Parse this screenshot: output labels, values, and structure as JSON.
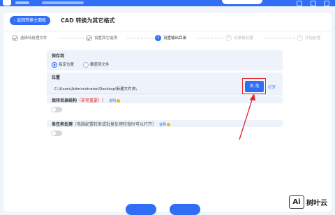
{
  "topbar": {
    "accent": "#2f6ef5"
  },
  "header": {
    "back_label": "返回转换主面板",
    "title": "CAD 转换为其它格式"
  },
  "steps": [
    {
      "num": "",
      "label": "选择待处理文件",
      "state": "done"
    },
    {
      "num": "",
      "label": "设置其它选项",
      "state": "done"
    },
    {
      "num": "3",
      "label": "设置输出目录",
      "state": "current"
    },
    {
      "num": "4",
      "label": "待录格处理",
      "state": "next"
    },
    {
      "num": "5",
      "label": "开始处理",
      "state": "next"
    }
  ],
  "save_to": {
    "label": "保存到",
    "options": [
      {
        "label": "指定位置",
        "selected": true
      },
      {
        "label": "覆盖原文件",
        "selected": false
      }
    ]
  },
  "location": {
    "label": "位置",
    "path": "C:\\Users\\Administrator\\Desktop\\新建文件夹\\",
    "browse_label": "浏 览",
    "open_label": "打开"
  },
  "keep_dir": {
    "label": "保持目录结构",
    "note": "（非常重要！）",
    "help_label": "说明",
    "enabled": false
  },
  "single_task": {
    "label": "单任务处理",
    "note": "（电脑配置较差或批量处理较慢时可以打开）",
    "help_label": "说明",
    "enabled": false
  },
  "watermark": {
    "logo": "Ai",
    "text": "树叶云"
  },
  "colors": {
    "highlight": "#e0282e",
    "accent": "#2f6ef5"
  }
}
